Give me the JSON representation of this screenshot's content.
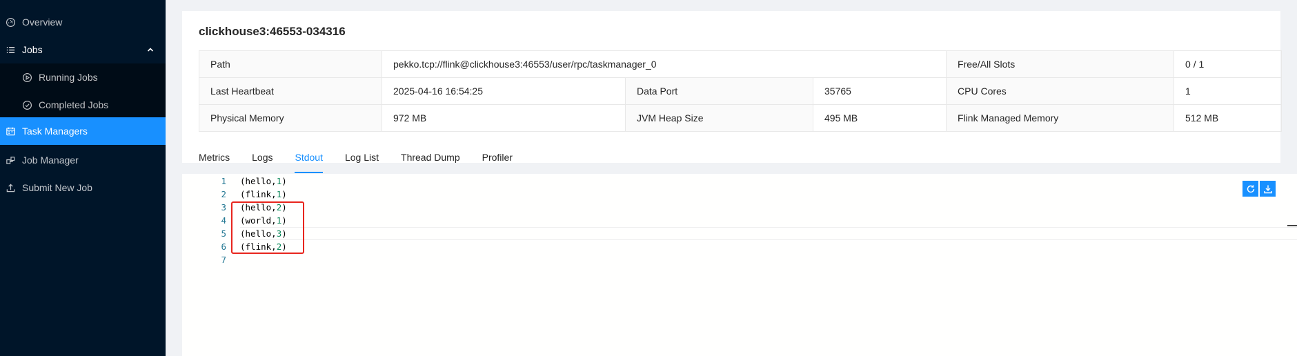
{
  "sidebar": {
    "items": [
      {
        "label": "Overview",
        "icon": "dashboard-icon",
        "active": false,
        "sub": false
      },
      {
        "label": "Jobs",
        "icon": "list-icon",
        "active": false,
        "sub": false,
        "expanded": true
      },
      {
        "label": "Running Jobs",
        "icon": "play-circle-icon",
        "active": false,
        "sub": true
      },
      {
        "label": "Completed Jobs",
        "icon": "check-circle-icon",
        "active": false,
        "sub": true
      },
      {
        "label": "Task Managers",
        "icon": "schedule-icon",
        "active": true,
        "sub": false
      },
      {
        "label": "Job Manager",
        "icon": "build-icon",
        "active": false,
        "sub": false
      },
      {
        "label": "Submit New Job",
        "icon": "upload-icon",
        "active": false,
        "sub": false
      }
    ]
  },
  "taskmanager": {
    "title": "clickhouse3:46553-034316",
    "path_label": "Path",
    "path_value": "pekko.tcp://flink@clickhouse3:46553/user/rpc/taskmanager_0",
    "slots_label": "Free/All Slots",
    "slots_value": "0 / 1",
    "heartbeat_label": "Last Heartbeat",
    "heartbeat_value": "2025-04-16 16:54:25",
    "dataport_label": "Data Port",
    "dataport_value": "35765",
    "cpu_label": "CPU Cores",
    "cpu_value": "1",
    "physmem_label": "Physical Memory",
    "physmem_value": "972 MB",
    "heap_label": "JVM Heap Size",
    "heap_value": "495 MB",
    "managed_label": "Flink Managed Memory",
    "managed_value": "512 MB"
  },
  "tabs": [
    "Metrics",
    "Logs",
    "Stdout",
    "Log List",
    "Thread Dump",
    "Profiler"
  ],
  "active_tab": "Stdout",
  "stdout": {
    "lines": [
      {
        "no": "1",
        "word": "hello",
        "count": "1"
      },
      {
        "no": "2",
        "word": "flink",
        "count": "1"
      },
      {
        "no": "3",
        "word": "hello",
        "count": "2"
      },
      {
        "no": "4",
        "word": "world",
        "count": "1"
      },
      {
        "no": "5",
        "word": "hello",
        "count": "3"
      },
      {
        "no": "6",
        "word": "flink",
        "count": "2"
      },
      {
        "no": "7",
        "word": "",
        "count": ""
      }
    ]
  },
  "toolbar": {
    "refresh_icon": "reload-icon",
    "download_icon": "download-icon"
  },
  "colors": {
    "sidebar_bg": "#001529",
    "accent": "#1890ff",
    "highlight_box": "#e8251d"
  }
}
